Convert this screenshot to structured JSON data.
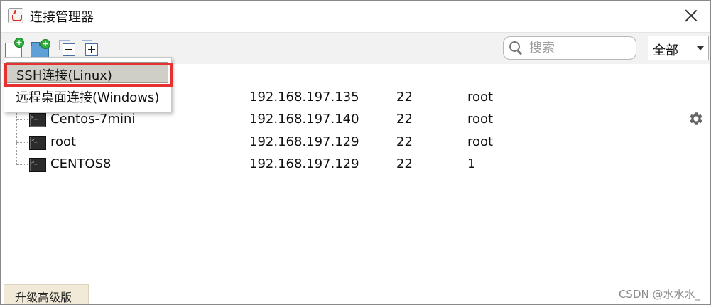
{
  "window": {
    "title": "连接管理器"
  },
  "toolbar": {
    "search_placeholder": "搜索",
    "filter_value": "全部"
  },
  "menu": {
    "items": [
      {
        "label": "SSH连接(Linux)",
        "selected": true
      },
      {
        "label": "远程桌面连接(Windows)",
        "selected": false
      }
    ]
  },
  "connections": [
    {
      "name": "",
      "host": "192.168.197.135",
      "port": "22",
      "user": "root"
    },
    {
      "name": "Centos-7mini",
      "host": "192.168.197.140",
      "port": "22",
      "user": "root"
    },
    {
      "name": "root",
      "host": "192.168.197.129",
      "port": "22",
      "user": "root"
    },
    {
      "name": "CENTOS8",
      "host": "192.168.197.129",
      "port": "22",
      "user": "1"
    }
  ],
  "statusbar": {
    "upgrade_label": "升级高级版",
    "watermark": "CSDN @水水水_"
  },
  "colors": {
    "highlight": "#e5312f",
    "toolbar_bg": "#f2f2f2",
    "upgrade_bg": "#f1ead8"
  }
}
